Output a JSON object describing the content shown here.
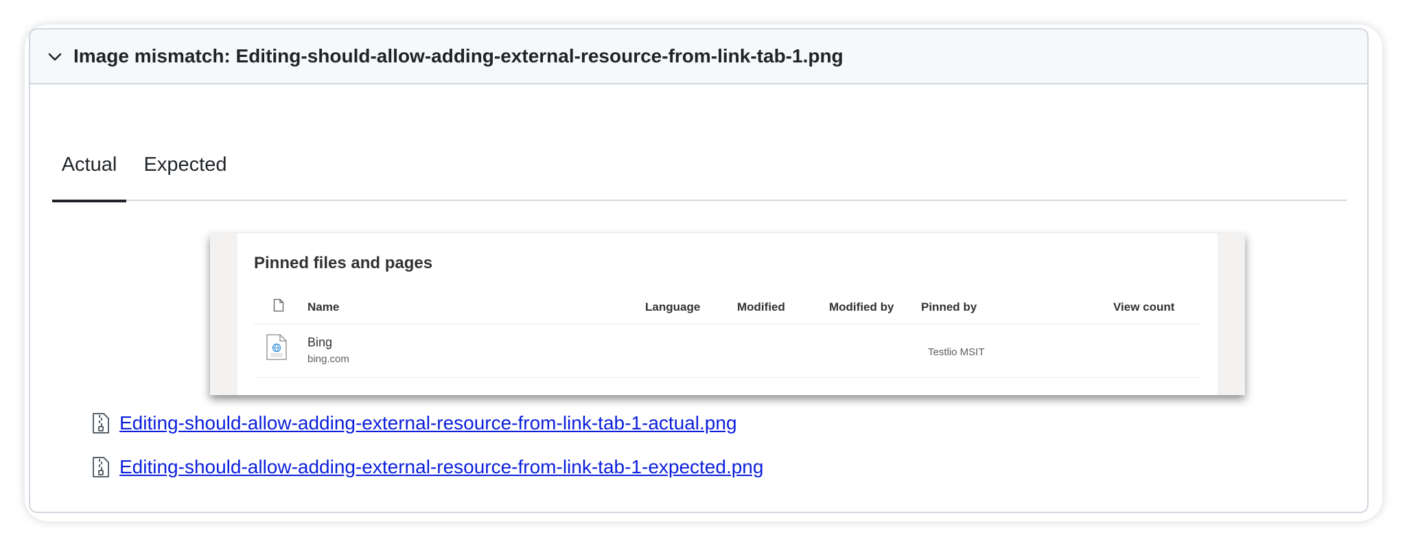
{
  "card": {
    "header_title": "Image mismatch: Editing-should-allow-adding-external-resource-from-link-tab-1.png",
    "expand_icon": "chevron-down-icon"
  },
  "tabs": [
    {
      "label": "Actual",
      "selected": true
    },
    {
      "label": "Expected",
      "selected": false
    }
  ],
  "screenshot": {
    "title": "Pinned files and pages",
    "columns": {
      "file_type_icon": "file-icon",
      "name": "Name",
      "language": "Language",
      "modified": "Modified",
      "modified_by": "Modified by",
      "pinned_by": "Pinned by",
      "view_count": "View count"
    },
    "rows": [
      {
        "icon": "globe-file-icon",
        "name": "Bing",
        "url": "bing.com",
        "language": "",
        "modified": "",
        "modified_by": "",
        "pinned_by": "Testlio MSIT",
        "view_count": ""
      }
    ]
  },
  "attachments": [
    {
      "icon": "zip-file-icon",
      "label": "Editing-should-allow-adding-external-resource-from-link-tab-1-actual.png"
    },
    {
      "icon": "zip-file-icon",
      "label": "Editing-should-allow-adding-external-resource-from-link-tab-1-expected.png"
    }
  ],
  "colors": {
    "link": "#0a1edb",
    "header_bg": "#f6f8fa",
    "border": "#d0d7de",
    "text": "#1f2328"
  }
}
